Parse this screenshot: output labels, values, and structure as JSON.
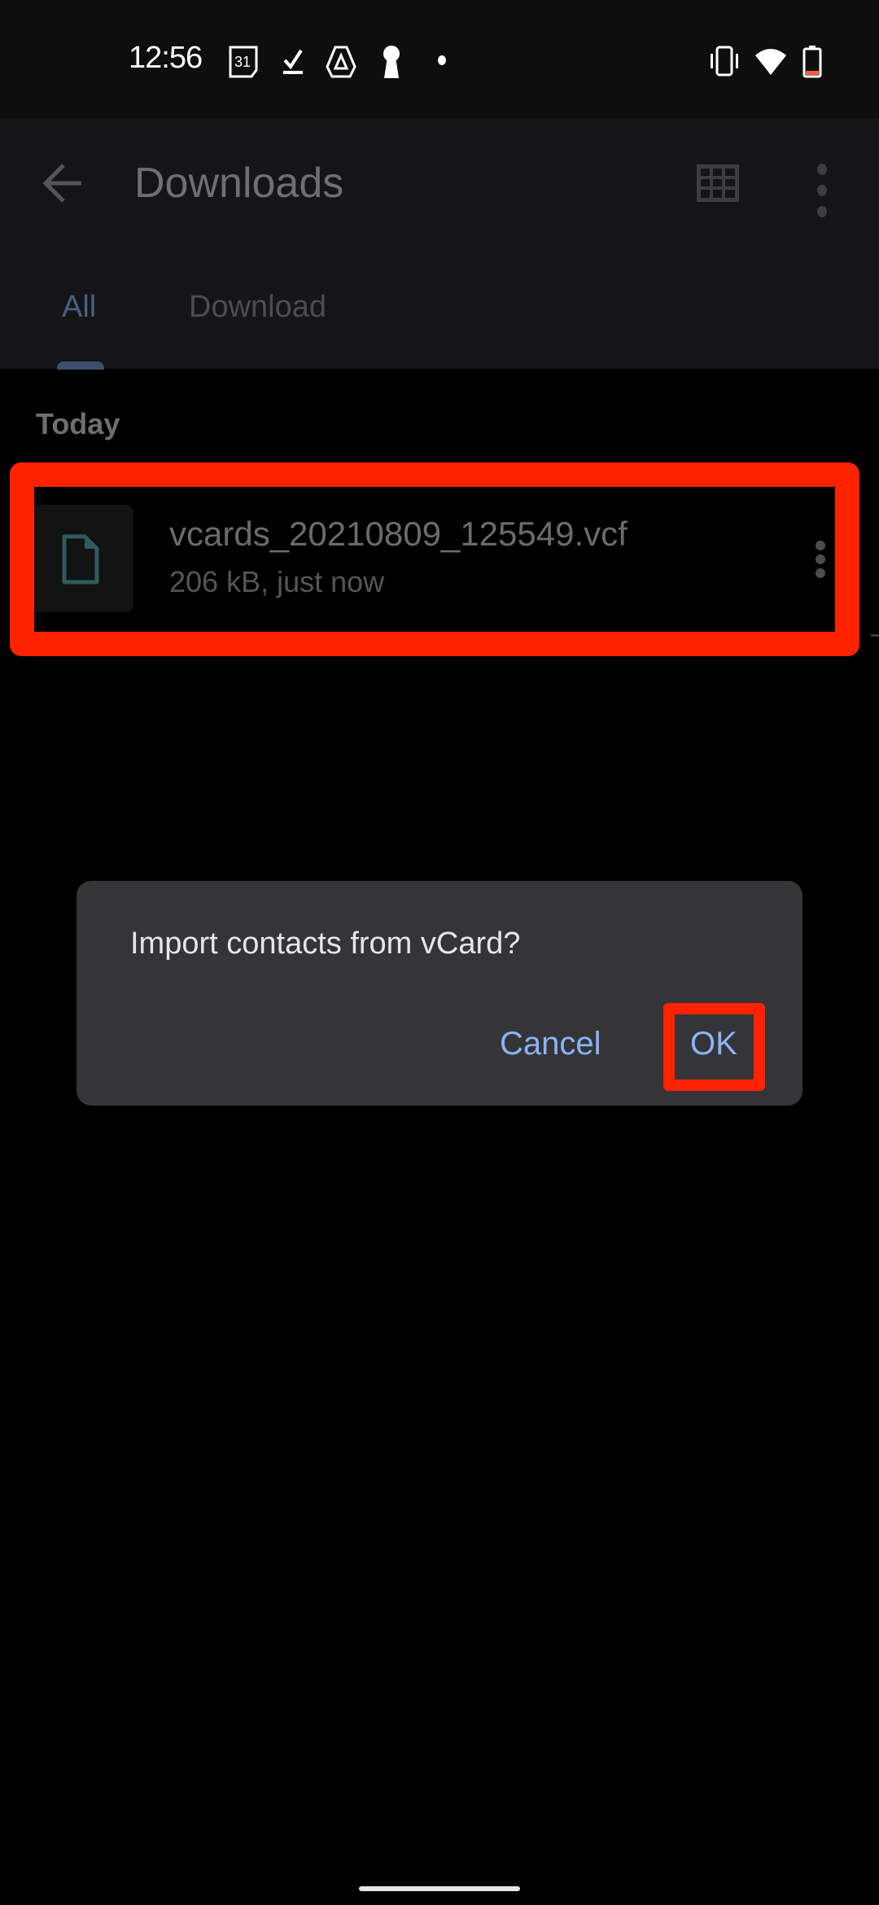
{
  "status_bar": {
    "time": "12:56",
    "left_icons": [
      "calendar-icon",
      "tasks-check-icon",
      "drive-icon",
      "keyhole-icon",
      "notification-dot-icon"
    ],
    "calendar_day": "31",
    "right_icons": [
      "vibrate-icon",
      "wifi-icon",
      "battery-low-icon"
    ]
  },
  "app_bar": {
    "title": "Downloads",
    "back_icon": "arrow-back-icon",
    "grid_icon": "grid-view-icon",
    "more_icon": "more-vert-icon"
  },
  "tabs": [
    {
      "label": "All",
      "selected": true
    },
    {
      "label": "Download",
      "selected": false
    }
  ],
  "section": {
    "header": "Today"
  },
  "files": [
    {
      "name": "vcards_20210809_125549.vcf",
      "meta": "206 kB, just now",
      "icon": "file-icon"
    }
  ],
  "dialog": {
    "message": "Import contacts from vCard?",
    "cancel_label": "Cancel",
    "ok_label": "OK"
  },
  "colors": {
    "accent": "#8ab4f8",
    "highlight": "#ff2200",
    "dialog_bg": "#353538"
  }
}
